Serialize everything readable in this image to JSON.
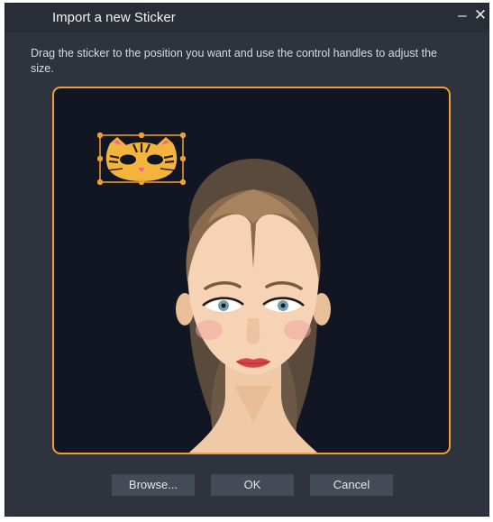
{
  "window": {
    "title": "Import a new Sticker",
    "minimize_glyph": "–",
    "close_glyph": "✕"
  },
  "instruction": "Drag the sticker to the position you want and use the control handles to adjust the size.",
  "preview": {
    "sticker_icon": "cat-face-sticker",
    "subject": "woman-face-illustration"
  },
  "buttons": {
    "browse": "Browse...",
    "ok": "OK",
    "cancel": "Cancel"
  },
  "colors": {
    "accent": "#f0a033",
    "background": "#2f333e",
    "canvas": "#121622",
    "button": "#454a57"
  }
}
